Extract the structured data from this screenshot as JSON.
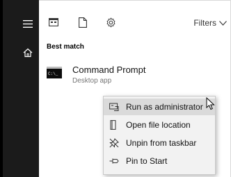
{
  "rail": {
    "icons": [
      "hamburger-menu-icon",
      "home-icon"
    ]
  },
  "toolbar": {
    "icons": [
      "apps-icon",
      "documents-icon",
      "settings-icon"
    ],
    "filters_label": "Filters",
    "filters_icon": "chevron-down-icon"
  },
  "results": {
    "section_title": "Best match",
    "best_match": {
      "title": "Command Prompt",
      "subtitle": "Desktop app",
      "icon": "command-prompt-icon",
      "icon_text": "C:\\_"
    }
  },
  "context_menu": {
    "items": [
      {
        "label": "Run as administrator",
        "icon": "shield-run-icon",
        "highlighted": true
      },
      {
        "label": "Open file location",
        "icon": "file-location-icon",
        "highlighted": false
      },
      {
        "label": "Unpin from taskbar",
        "icon": "unpin-icon",
        "highlighted": false
      },
      {
        "label": "Pin to Start",
        "icon": "pin-icon",
        "highlighted": false
      }
    ]
  },
  "colors": {
    "rail_bg": "#1b1b1b",
    "menu_bg": "#f2f2f2",
    "menu_highlight": "#dadada"
  }
}
